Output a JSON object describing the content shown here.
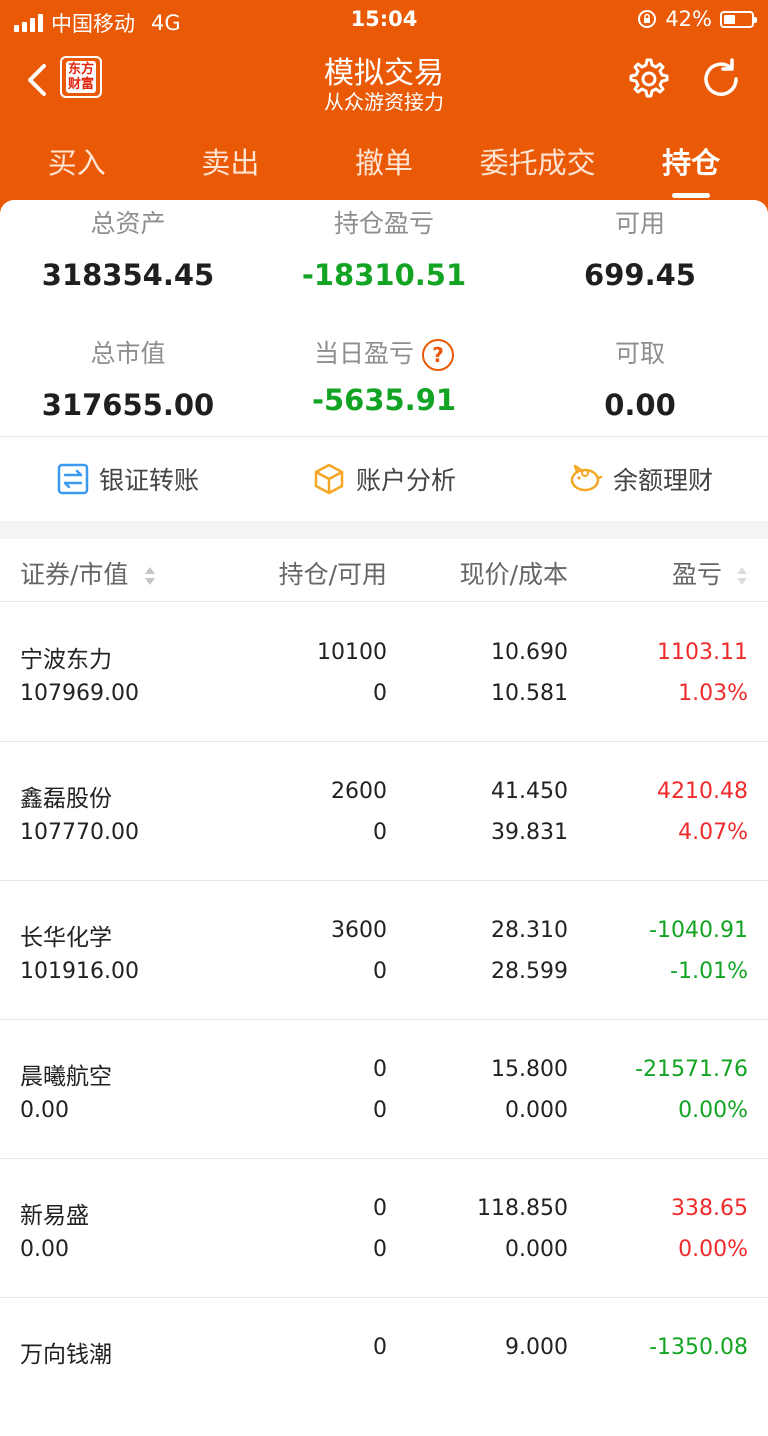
{
  "status": {
    "carrier": "中国移动",
    "network": "4G",
    "time": "15:04",
    "battery": "42%",
    "battery_level": 0.42
  },
  "nav": {
    "logo_line1": "东方",
    "logo_line2": "财富",
    "title": "模拟交易",
    "subtitle": "从众游资接力"
  },
  "tabs": [
    {
      "label": "买入"
    },
    {
      "label": "卖出"
    },
    {
      "label": "撤单"
    },
    {
      "label": "委托成交"
    },
    {
      "label": "持仓"
    }
  ],
  "summary": {
    "total_assets": {
      "label": "总资产",
      "value": "318354.45"
    },
    "position_pl": {
      "label": "持仓盈亏",
      "value": "-18310.51"
    },
    "available": {
      "label": "可用",
      "value": "699.45"
    },
    "market_value": {
      "label": "总市值",
      "value": "317655.00"
    },
    "daily_pl": {
      "label": "当日盈亏",
      "value": "-5635.91"
    },
    "withdrawable": {
      "label": "可取",
      "value": "0.00"
    }
  },
  "actions": [
    {
      "label": "银证转账",
      "icon": "transfer-icon"
    },
    {
      "label": "账户分析",
      "icon": "box-icon"
    },
    {
      "label": "余额理财",
      "icon": "piggy-bank-icon"
    }
  ],
  "table": {
    "headers": {
      "security": "证券/市值",
      "position": "持仓/可用",
      "price": "现价/成本",
      "pl": "盈亏"
    },
    "rows": [
      {
        "name": "宁波东力",
        "market_value": "107969.00",
        "qty": "10100",
        "avail": "0",
        "price": "10.690",
        "cost": "10.581",
        "pl": "1103.11",
        "pl_pct": "1.03%",
        "color": "red"
      },
      {
        "name": "鑫磊股份",
        "market_value": "107770.00",
        "qty": "2600",
        "avail": "0",
        "price": "41.450",
        "cost": "39.831",
        "pl": "4210.48",
        "pl_pct": "4.07%",
        "color": "red"
      },
      {
        "name": "长华化学",
        "market_value": "101916.00",
        "qty": "3600",
        "avail": "0",
        "price": "28.310",
        "cost": "28.599",
        "pl": "-1040.91",
        "pl_pct": "-1.01%",
        "color": "green"
      },
      {
        "name": "晨曦航空",
        "market_value": "0.00",
        "qty": "0",
        "avail": "0",
        "price": "15.800",
        "cost": "0.000",
        "pl": "-21571.76",
        "pl_pct": "0.00%",
        "color": "green"
      },
      {
        "name": "新易盛",
        "market_value": "0.00",
        "qty": "0",
        "avail": "0",
        "price": "118.850",
        "cost": "0.000",
        "pl": "338.65",
        "pl_pct": "0.00%",
        "color": "red"
      },
      {
        "name": "万向钱潮",
        "market_value": "",
        "qty": "0",
        "avail": "",
        "price": "9.000",
        "cost": "",
        "pl": "-1350.08",
        "pl_pct": "",
        "color": "green"
      }
    ]
  },
  "colors": {
    "brand": "#ea5a06",
    "gain": "#ef2b2b",
    "loss": "#13a424"
  }
}
